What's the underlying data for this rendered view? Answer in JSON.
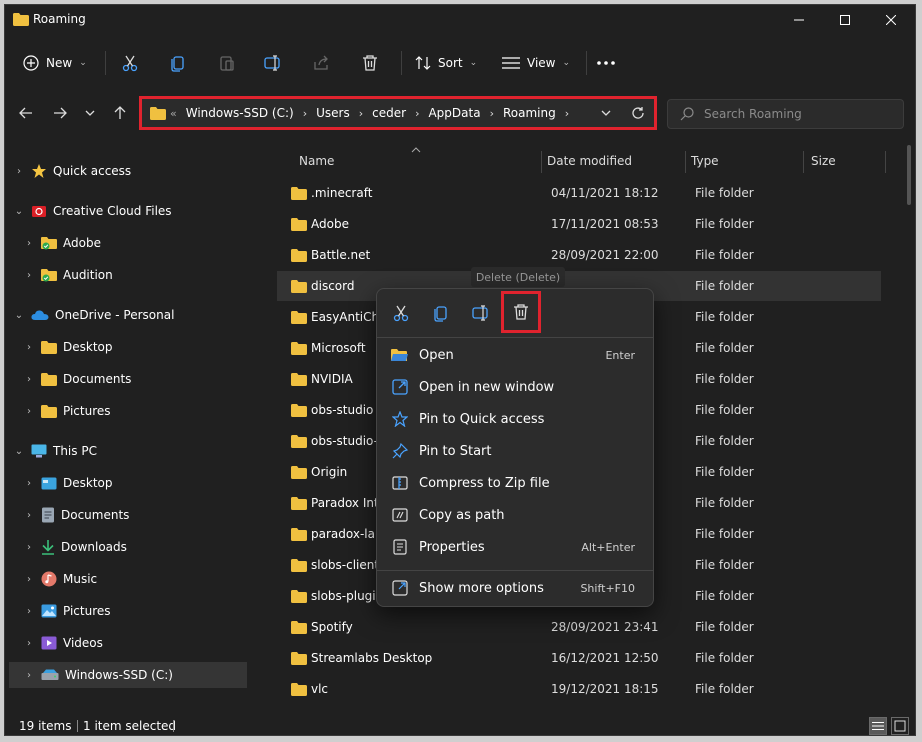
{
  "window": {
    "title": "Roaming"
  },
  "toolbar": {
    "new_label": "New",
    "sort_label": "Sort",
    "view_label": "View"
  },
  "address": {
    "crumbs": [
      "Windows-SSD (C:)",
      "Users",
      "ceder",
      "AppData",
      "Roaming"
    ],
    "overflow": "«"
  },
  "search": {
    "placeholder": "Search Roaming"
  },
  "sidebar": {
    "items": [
      {
        "label": "Quick access",
        "icon": "star-icon"
      },
      {
        "label": "Creative Cloud Files",
        "icon": "creative-cloud-icon"
      },
      {
        "label": "Adobe",
        "icon": "folder-icon"
      },
      {
        "label": "Audition",
        "icon": "folder-icon"
      },
      {
        "label": "OneDrive - Personal",
        "icon": "cloud-icon"
      },
      {
        "label": "Desktop",
        "icon": "folder-icon"
      },
      {
        "label": "Documents",
        "icon": "folder-icon"
      },
      {
        "label": "Pictures",
        "icon": "folder-icon"
      },
      {
        "label": "This PC",
        "icon": "pc-icon"
      },
      {
        "label": "Desktop",
        "icon": "desktop-icon"
      },
      {
        "label": "Documents",
        "icon": "documents-icon"
      },
      {
        "label": "Downloads",
        "icon": "download-icon"
      },
      {
        "label": "Music",
        "icon": "music-icon"
      },
      {
        "label": "Pictures",
        "icon": "pictures-icon"
      },
      {
        "label": "Videos",
        "icon": "videos-icon"
      },
      {
        "label": "Windows-SSD (C:)",
        "icon": "drive-icon"
      }
    ]
  },
  "columns": {
    "name": "Name",
    "date": "Date modified",
    "type": "Type",
    "size": "Size"
  },
  "files": [
    {
      "name": ".minecraft",
      "date": "04/11/2021 18:12",
      "type": "File folder"
    },
    {
      "name": "Adobe",
      "date": "17/11/2021 08:53",
      "type": "File folder"
    },
    {
      "name": "Battle.net",
      "date": "28/09/2021 22:00",
      "type": "File folder"
    },
    {
      "name": "discord",
      "date": "",
      "type": "File folder"
    },
    {
      "name": "EasyAntiChe",
      "date": "",
      "type": "File folder"
    },
    {
      "name": "Microsoft",
      "date": "",
      "type": "File folder"
    },
    {
      "name": "NVIDIA",
      "date": "",
      "type": "File folder"
    },
    {
      "name": "obs-studio",
      "date": "",
      "type": "File folder"
    },
    {
      "name": "obs-studio-r",
      "date": "",
      "type": "File folder"
    },
    {
      "name": "Origin",
      "date": "",
      "type": "File folder"
    },
    {
      "name": "Paradox Inte",
      "date": "",
      "type": "File folder"
    },
    {
      "name": "paradox-lau",
      "date": "",
      "type": "File folder"
    },
    {
      "name": "slobs-client",
      "date": "",
      "type": "File folder"
    },
    {
      "name": "slobs-plugin",
      "date": "",
      "type": "File folder"
    },
    {
      "name": "Spotify",
      "date": "28/09/2021 23:41",
      "type": "File folder"
    },
    {
      "name": "Streamlabs Desktop",
      "date": "16/12/2021 12:50",
      "type": "File folder"
    },
    {
      "name": "vlc",
      "date": "19/12/2021 18:15",
      "type": "File folder"
    }
  ],
  "tooltip": "Delete (Delete)",
  "context_menu": {
    "items": [
      {
        "label": "Open",
        "key": "Enter",
        "icon": "open-folder-icon"
      },
      {
        "label": "Open in new window",
        "key": "",
        "icon": "new-window-icon"
      },
      {
        "label": "Pin to Quick access",
        "key": "",
        "icon": "star-outline-icon"
      },
      {
        "label": "Pin to Start",
        "key": "",
        "icon": "pin-icon"
      },
      {
        "label": "Compress to Zip file",
        "key": "",
        "icon": "zip-icon"
      },
      {
        "label": "Copy as path",
        "key": "",
        "icon": "copy-path-icon"
      },
      {
        "label": "Properties",
        "key": "Alt+Enter",
        "icon": "properties-icon"
      },
      {
        "label": "Show more options",
        "key": "Shift+F10",
        "icon": "more-options-icon"
      }
    ]
  },
  "status": {
    "items": "19 items",
    "selected": "1 item selected"
  },
  "colors": {
    "accent": "#e0232e",
    "folder": "#f0c040",
    "background": "#202020"
  }
}
